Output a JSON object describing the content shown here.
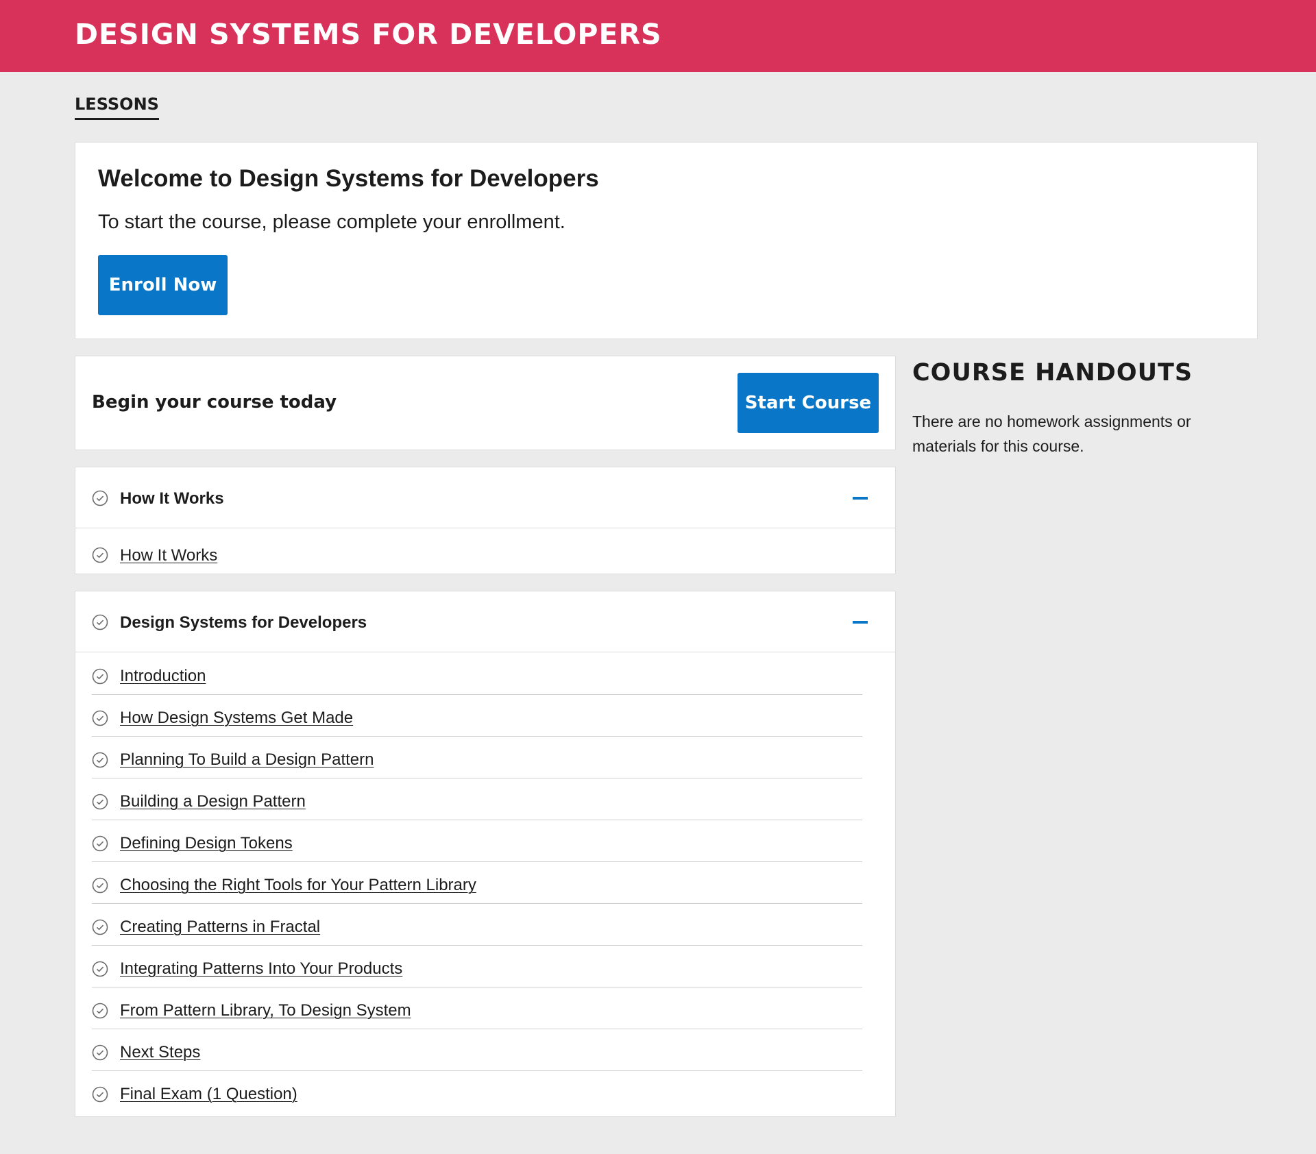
{
  "header": {
    "title": "DESIGN SYSTEMS FOR DEVELOPERS",
    "bg_color": "#d8325a"
  },
  "nav": {
    "lessons_label": "LESSONS"
  },
  "welcome": {
    "title": "Welcome to Design Systems for Developers",
    "text": "To start the course, please complete your enrollment.",
    "enroll_label": "Enroll Now"
  },
  "begin": {
    "text": "Begin your course today",
    "start_label": "Start Course"
  },
  "handouts": {
    "title": "COURSE HANDOUTS",
    "text": "There are no homework assignments or materials for this course."
  },
  "sections": [
    {
      "title": "How It Works",
      "collapse_icon": "minus-icon",
      "lessons": [
        "How It Works"
      ]
    },
    {
      "title": "Design Systems for Developers",
      "collapse_icon": "minus-icon",
      "lessons": [
        "Introduction",
        "How Design Systems Get Made",
        "Planning To Build a Design Pattern",
        "Building a Design Pattern",
        "Defining Design Tokens",
        "Choosing the Right Tools for Your Pattern Library",
        "Creating Patterns in Fractal",
        "Integrating Patterns Into Your Products",
        "From Pattern Library, To Design System",
        "Next Steps",
        "Final Exam (1 Question)"
      ]
    }
  ],
  "colors": {
    "accent": "#0a76c7",
    "page_bg": "#ebebeb",
    "brand": "#d8325a"
  }
}
